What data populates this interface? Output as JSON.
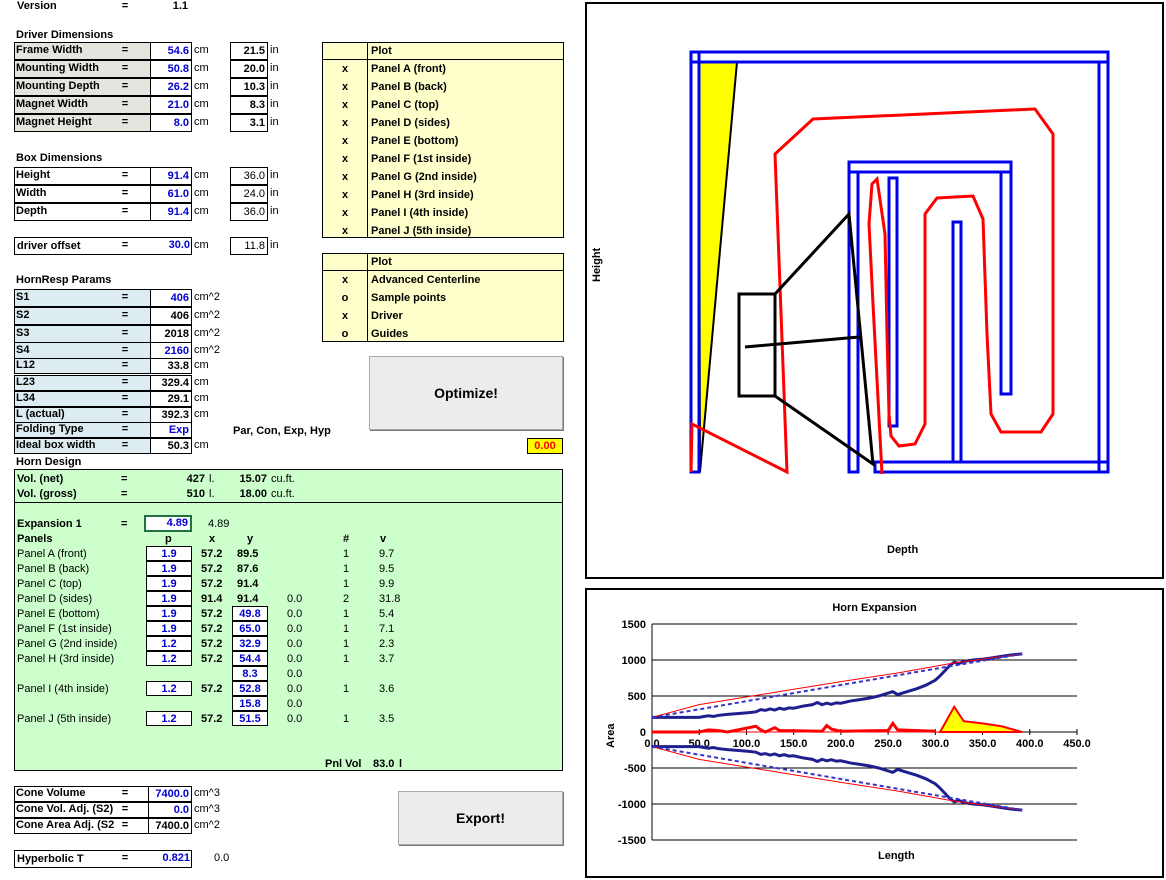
{
  "version": {
    "label": "Version",
    "eq": "=",
    "value": "1.1"
  },
  "driver": {
    "title": "Driver Dimensions",
    "rows": [
      {
        "label": "Frame Width",
        "eq": "=",
        "value": "54.6",
        "unit": "cm",
        "inch": "21.5",
        "in_unit": "in"
      },
      {
        "label": "Mounting Width",
        "eq": "=",
        "value": "50.8",
        "unit": "cm",
        "inch": "20.0",
        "in_unit": "in"
      },
      {
        "label": "Mounting Depth",
        "eq": "=",
        "value": "26.2",
        "unit": "cm",
        "inch": "10.3",
        "in_unit": "in"
      },
      {
        "label": "Magnet Width",
        "eq": "=",
        "value": "21.0",
        "unit": "cm",
        "inch": "8.3",
        "in_unit": "in"
      },
      {
        "label": "Magnet Height",
        "eq": "=",
        "value": "8.0",
        "unit": "cm",
        "inch": "3.1",
        "in_unit": "in"
      }
    ]
  },
  "box": {
    "title": "Box Dimensions",
    "rows": [
      {
        "label": "Height",
        "eq": "=",
        "value": "91.4",
        "unit": "cm",
        "inch": "36.0",
        "in_unit": "in"
      },
      {
        "label": "Width",
        "eq": "=",
        "value": "61.0",
        "unit": "cm",
        "inch": "24.0",
        "in_unit": "in"
      },
      {
        "label": "Depth",
        "eq": "=",
        "value": "91.4",
        "unit": "cm",
        "inch": "36.0",
        "in_unit": "in"
      }
    ],
    "offset": {
      "label": "driver offset",
      "eq": "=",
      "value": "30.0",
      "unit": "cm",
      "inch": "11.8",
      "in_unit": "in"
    }
  },
  "hornresp": {
    "title": "HornResp Params",
    "rows": [
      {
        "label": "S1",
        "eq": "=",
        "value": "406",
        "unit": "cm^2",
        "blue": true
      },
      {
        "label": "S2",
        "eq": "=",
        "value": "406",
        "unit": "cm^2",
        "blue": false
      },
      {
        "label": "S3",
        "eq": "=",
        "value": "2018",
        "unit": "cm^2",
        "blue": false
      },
      {
        "label": "S4",
        "eq": "=",
        "value": "2160",
        "unit": "cm^2",
        "blue": true
      },
      {
        "label": "L12",
        "eq": "=",
        "value": "33.8",
        "unit": "cm",
        "blue": false
      },
      {
        "label": "L23",
        "eq": "=",
        "value": "329.4",
        "unit": "cm",
        "blue": false
      },
      {
        "label": "L34",
        "eq": "=",
        "value": "29.1",
        "unit": "cm",
        "blue": false
      },
      {
        "label": "L (actual)",
        "eq": "=",
        "value": "392.3",
        "unit": "cm",
        "blue": false
      },
      {
        "label": "Folding Type",
        "eq": "=",
        "value": "Exp",
        "unit": "",
        "blue": true
      },
      {
        "label": "Ideal box width",
        "eq": "=",
        "value": "50.3",
        "unit": "cm",
        "blue": false
      }
    ],
    "folding_options": "Par, Con, Exp, Hyp",
    "indicator": "0.00"
  },
  "plot1": {
    "header": "Plot",
    "rows": [
      {
        "mark": "x",
        "label": "Panel A (front)"
      },
      {
        "mark": "x",
        "label": "Panel B (back)"
      },
      {
        "mark": "x",
        "label": "Panel C (top)"
      },
      {
        "mark": "x",
        "label": "Panel D (sides)"
      },
      {
        "mark": "x",
        "label": "Panel E (bottom)"
      },
      {
        "mark": "x",
        "label": "Panel F (1st inside)"
      },
      {
        "mark": "x",
        "label": "Panel G (2nd inside)"
      },
      {
        "mark": "x",
        "label": "Panel H (3rd inside)"
      },
      {
        "mark": "x",
        "label": "Panel I (4th inside)"
      },
      {
        "mark": "x",
        "label": "Panel J (5th inside)"
      }
    ]
  },
  "plot2": {
    "header": "Plot",
    "rows": [
      {
        "mark": "x",
        "label": "Advanced Centerline"
      },
      {
        "mark": "o",
        "label": "Sample points"
      },
      {
        "mark": "x",
        "label": "Driver"
      },
      {
        "mark": "o",
        "label": "Guides"
      }
    ]
  },
  "buttons": {
    "optimize": "Optimize!",
    "export": "Export!"
  },
  "horn": {
    "title": "Horn Design",
    "vol_net": {
      "label": "Vol. (net)",
      "eq": "=",
      "value": "427",
      "unit": "l.",
      "cuft": "15.07",
      "cuft_unit": "cu.ft."
    },
    "vol_gross": {
      "label": "Vol. (gross)",
      "eq": "=",
      "value": "510",
      "unit": "l.",
      "cuft": "18.00",
      "cuft_unit": "cu.ft."
    },
    "expansion": {
      "label": "Expansion 1",
      "eq": "=",
      "value": "4.89",
      "echo": "4.89"
    },
    "headers": {
      "panels": "Panels",
      "p": "p",
      "x": "x",
      "y": "y",
      "n": "#",
      "v": "v"
    },
    "panels": [
      {
        "name": "Panel A (front)",
        "p": "1.9",
        "x": "57.2",
        "y": "89.5",
        "z": "",
        "n": "1",
        "v": "9.7",
        "yb": false
      },
      {
        "name": "Panel B (back)",
        "p": "1.9",
        "x": "57.2",
        "y": "87.6",
        "z": "",
        "n": "1",
        "v": "9.5",
        "yb": false
      },
      {
        "name": "Panel C (top)",
        "p": "1.9",
        "x": "57.2",
        "y": "91.4",
        "z": "",
        "n": "1",
        "v": "9.9",
        "yb": false
      },
      {
        "name": "Panel D (sides)",
        "p": "1.9",
        "x": "91.4",
        "y": "91.4",
        "z": "0.0",
        "n": "2",
        "v": "31.8",
        "yb": false
      },
      {
        "name": "Panel E (bottom)",
        "p": "1.9",
        "x": "57.2",
        "y": "49.8",
        "z": "0.0",
        "n": "1",
        "v": "5.4",
        "yb": true
      },
      {
        "name": "Panel F (1st inside)",
        "p": "1.9",
        "x": "57.2",
        "y": "65.0",
        "z": "0.0",
        "n": "1",
        "v": "7.1",
        "yb": true
      },
      {
        "name": "Panel G (2nd inside)",
        "p": "1.2",
        "x": "57.2",
        "y": "32.9",
        "z": "0.0",
        "n": "1",
        "v": "2.3",
        "yb": true
      },
      {
        "name": "Panel H (3rd inside)",
        "p": "1.2",
        "x": "57.2",
        "y": "54.4",
        "z": "0.0",
        "n": "1",
        "v": "3.7",
        "yb": true
      }
    ],
    "extra1": {
      "y": "8.3",
      "z": "0.0"
    },
    "panel_i": {
      "name": "Panel I (4th inside)",
      "p": "1.2",
      "x": "57.2",
      "y": "52.8",
      "z": "0.0",
      "n": "1",
      "v": "3.6"
    },
    "extra2": {
      "y": "15.8",
      "z": "0.0"
    },
    "panel_j": {
      "name": "Panel J (5th inside)",
      "p": "1.2",
      "x": "57.2",
      "y": "51.5",
      "z": "0.0",
      "n": "1",
      "v": "3.5"
    },
    "pnlvol": {
      "label": "Pnl Vol",
      "value": "83.0",
      "unit": "l"
    }
  },
  "cone": {
    "rows": [
      {
        "label": "Cone Volume",
        "eq": "=",
        "value": "7400.0",
        "unit": "cm^3",
        "blue": true
      },
      {
        "label": "Cone Vol. Adj. (S2)",
        "eq": "=",
        "value": "0.0",
        "unit": "cm^3",
        "blue": true
      },
      {
        "label": "Cone Area Adj. (S2",
        "eq": "=",
        "value": "7400.0",
        "unit": "cm^2",
        "blue": false
      }
    ],
    "hyper": {
      "label": "Hyperbolic T",
      "eq": "=",
      "value": "0.821",
      "echo": "0.0"
    }
  },
  "layout_plot": {
    "ylabel": "Height",
    "xlabel": "Depth"
  },
  "chart_data": {
    "type": "area",
    "title": "Horn Expansion",
    "xlabel": "Length",
    "ylabel": "Area",
    "xlim": [
      0,
      450
    ],
    "ylim": [
      -1500,
      1500
    ],
    "xticks": [
      "0.0",
      "50.0",
      "100.0",
      "150.0",
      "200.0",
      "250.0",
      "300.0",
      "350.0",
      "400.0",
      "450.0"
    ],
    "yticks": [
      "1500",
      "1000",
      "500",
      "0",
      "-500",
      "-1000",
      "-1500"
    ],
    "grid": true,
    "series": [
      {
        "color": "#1f1f8f",
        "x": [
          0,
          20,
          40,
          50,
          55,
          60,
          65,
          70,
          80,
          90,
          100,
          110,
          115,
          120,
          125,
          130,
          135,
          140,
          145,
          150,
          160,
          170,
          175,
          180,
          185,
          190,
          195,
          200,
          210,
          220,
          230,
          240,
          250,
          255,
          260,
          270,
          280,
          290,
          300,
          305,
          310,
          315,
          320,
          325,
          330,
          340,
          350,
          360,
          370,
          380,
          392
        ],
        "y": [
          203,
          203,
          203,
          203,
          215,
          225,
          215,
          230,
          245,
          255,
          265,
          280,
          310,
          300,
          320,
          305,
          330,
          315,
          335,
          330,
          360,
          380,
          410,
          380,
          400,
          385,
          405,
          400,
          430,
          450,
          470,
          500,
          540,
          560,
          520,
          560,
          600,
          650,
          720,
          780,
          850,
          920,
          970,
          950,
          980,
          1000,
          1010,
          1030,
          1050,
          1070,
          1085
        ]
      },
      {
        "color": "#ff0000",
        "x": [
          0,
          50,
          120,
          200,
          260,
          320,
          392
        ],
        "y": [
          203,
          380,
          530,
          700,
          820,
          960,
          1085
        ]
      },
      {
        "color": "#ff0000",
        "x": [
          0,
          392
        ],
        "y": [
          0,
          0
        ]
      }
    ],
    "area_regions": [
      {
        "color": "#ffff00",
        "x": [
          305,
          320,
          330,
          350,
          370,
          392
        ],
        "y": [
          0,
          350,
          150,
          120,
          80,
          0
        ]
      }
    ]
  }
}
